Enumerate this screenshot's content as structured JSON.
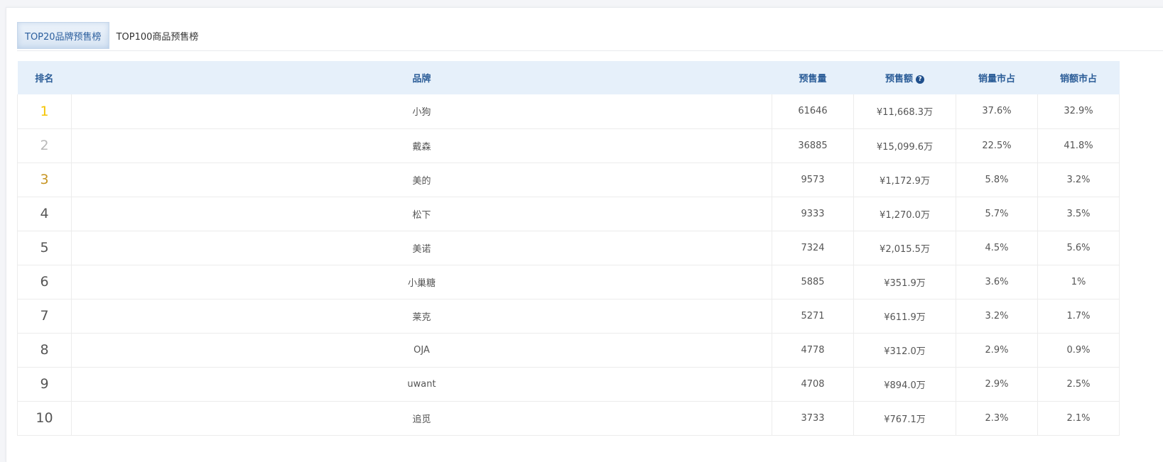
{
  "tabs": [
    {
      "label": "TOP20品牌预售榜"
    },
    {
      "label": "TOP100商品预售榜"
    }
  ],
  "columns": {
    "rank": "排名",
    "brand": "品牌",
    "presale_qty": "预售量",
    "presale_amount": "预售额",
    "qty_share": "销量市占",
    "amount_share": "销额市占"
  },
  "help_icon": "?",
  "rows": [
    {
      "rank": "1",
      "brand": "小狗",
      "qty": "61646",
      "amount": "¥11,668.3万",
      "qty_share": "37.6%",
      "amount_share": "32.9%"
    },
    {
      "rank": "2",
      "brand": "戴森",
      "qty": "36885",
      "amount": "¥15,099.6万",
      "qty_share": "22.5%",
      "amount_share": "41.8%"
    },
    {
      "rank": "3",
      "brand": "美的",
      "qty": "9573",
      "amount": "¥1,172.9万",
      "qty_share": "5.8%",
      "amount_share": "3.2%"
    },
    {
      "rank": "4",
      "brand": "松下",
      "qty": "9333",
      "amount": "¥1,270.0万",
      "qty_share": "5.7%",
      "amount_share": "3.5%"
    },
    {
      "rank": "5",
      "brand": "美诺",
      "qty": "7324",
      "amount": "¥2,015.5万",
      "qty_share": "4.5%",
      "amount_share": "5.6%"
    },
    {
      "rank": "6",
      "brand": "小巢糖",
      "qty": "5885",
      "amount": "¥351.9万",
      "qty_share": "3.6%",
      "amount_share": "1%"
    },
    {
      "rank": "7",
      "brand": "莱克",
      "qty": "5271",
      "amount": "¥611.9万",
      "qty_share": "3.2%",
      "amount_share": "1.7%"
    },
    {
      "rank": "8",
      "brand": "OJA",
      "qty": "4778",
      "amount": "¥312.0万",
      "qty_share": "2.9%",
      "amount_share": "0.9%"
    },
    {
      "rank": "9",
      "brand": "uwant",
      "qty": "4708",
      "amount": "¥894.0万",
      "qty_share": "2.9%",
      "amount_share": "2.5%"
    },
    {
      "rank": "10",
      "brand": "追觅",
      "qty": "3733",
      "amount": "¥767.1万",
      "qty_share": "2.3%",
      "amount_share": "2.1%"
    }
  ]
}
